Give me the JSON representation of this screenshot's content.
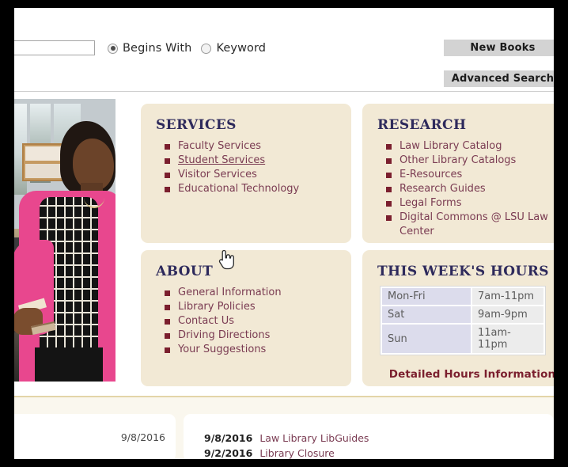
{
  "header": {
    "search_value": "",
    "search_placeholder": "",
    "radios": [
      {
        "label": "Begins With",
        "checked": true
      },
      {
        "label": "Keyword",
        "checked": false
      }
    ],
    "buttons": {
      "new_books": "New Books",
      "advanced_search": "Advanced Search"
    }
  },
  "panels": {
    "services": {
      "title": "SERVICES",
      "items": [
        {
          "label": "Faculty Services",
          "hovered": false
        },
        {
          "label": "Student Services",
          "hovered": true
        },
        {
          "label": "Visitor Services",
          "hovered": false
        },
        {
          "label": "Educational Technology",
          "hovered": false
        }
      ]
    },
    "research": {
      "title": "RESEARCH",
      "items": [
        {
          "label": "Law Library Catalog",
          "hovered": false
        },
        {
          "label": "Other Library Catalogs",
          "hovered": false
        },
        {
          "label": "E-Resources",
          "hovered": false
        },
        {
          "label": "Research Guides",
          "hovered": false
        },
        {
          "label": "Legal Forms",
          "hovered": false
        },
        {
          "label": "Digital Commons @ LSU Law Center",
          "hovered": false
        }
      ]
    },
    "about": {
      "title": "ABOUT",
      "items": [
        {
          "label": "General Information",
          "hovered": false
        },
        {
          "label": "Library Policies",
          "hovered": false
        },
        {
          "label": "Contact Us",
          "hovered": false
        },
        {
          "label": "Driving Directions",
          "hovered": false
        },
        {
          "label": "Your Suggestions",
          "hovered": false
        }
      ]
    },
    "hours": {
      "title": "THIS WEEK'S HOURS",
      "rows": [
        {
          "day": "Mon-Fri",
          "time": "7am-11pm"
        },
        {
          "day": "Sat",
          "time": "9am-9pm"
        },
        {
          "day": "Sun",
          "time": "11am-11pm"
        }
      ],
      "detail_link": "Detailed Hours Information"
    }
  },
  "news": {
    "left_date": "9/8/2016",
    "items": [
      {
        "date": "9/8/2016",
        "title": "Law Library LibGuides"
      },
      {
        "date": "9/2/2016",
        "title": "Library Closure"
      }
    ]
  },
  "colors": {
    "panel_bg": "#f2e9d5",
    "page_cream": "#faf7ee",
    "heading": "#2e2a5c",
    "link": "#7a3b52",
    "bullet": "#7b1f2e",
    "accent_maroon": "#7b1f2e",
    "divider": "#e3d5a8",
    "button_bg": "#d3d3d3",
    "table_day_bg": "#dcdcec",
    "table_time_bg": "#ececec"
  }
}
